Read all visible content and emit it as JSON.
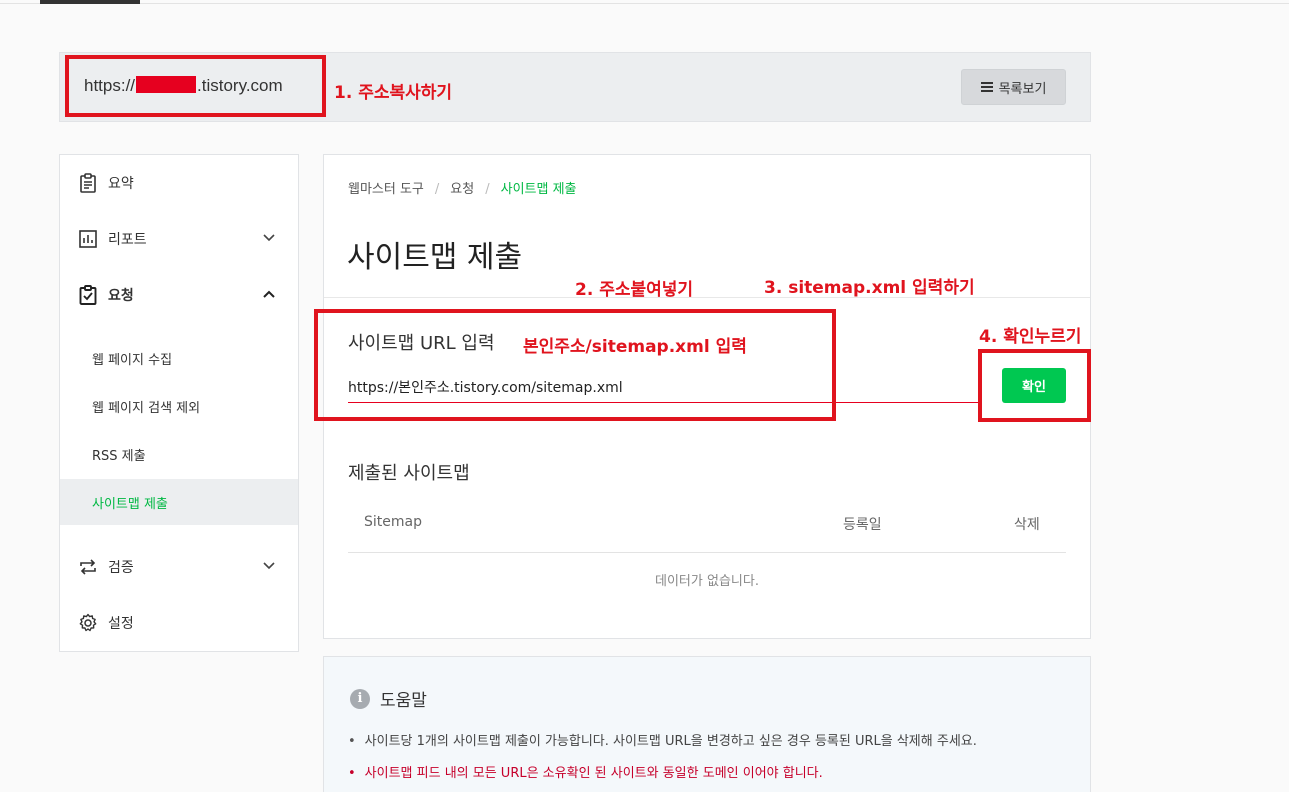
{
  "header": {
    "url_prefix": "https://",
    "url_suffix": ".tistory.com",
    "list_button": "목록보기"
  },
  "sidebar": {
    "items": [
      {
        "label": "요약",
        "icon": "clipboard-icon"
      },
      {
        "label": "리포트",
        "icon": "bar-chart-icon"
      },
      {
        "label": "요청",
        "icon": "clipboard-check-icon"
      },
      {
        "label": "검증",
        "icon": "swap-arrows-icon"
      },
      {
        "label": "설정",
        "icon": "gear-icon"
      }
    ],
    "sub_items": [
      {
        "label": "웹 페이지 수집"
      },
      {
        "label": "웹 페이지 검색 제외"
      },
      {
        "label": "RSS 제출"
      },
      {
        "label": "사이트맵 제출",
        "active": true
      }
    ]
  },
  "breadcrumb": {
    "items": [
      "웹마스터 도구",
      "요청",
      "사이트맵 제출"
    ],
    "separator": "/"
  },
  "main": {
    "title": "사이트맵 제출",
    "url_label": "사이트맵 URL 입력",
    "url_value": "https://본인주소.tistory.com/sitemap.xml",
    "confirm_button": "확인",
    "submitted_title": "제출된 사이트맵",
    "table_headers": [
      "Sitemap",
      "등록일",
      "삭제"
    ],
    "empty_text": "데이터가 없습니다."
  },
  "help": {
    "title": "도움말",
    "bullets": [
      "사이트당 1개의 사이트맵 제출이 가능합니다. 사이트맵 URL을 변경하고 싶은 경우 등록된 URL을 삭제해 주세요.",
      "사이트맵 피드 내의 모든 URL은 소유확인 된 사이트와 동일한 도메인 이어야 합니다."
    ]
  },
  "annotations": {
    "step1": "1. 주소복사하기",
    "step2": "2. 주소붙여넣기",
    "step3": "3. sitemap.xml 입력하기",
    "step4": "4. 확인누르기",
    "inline_note": "본인주소/sitemap.xml 입력"
  },
  "colors": {
    "accent_green": "#00c851",
    "annotation_red": "#e0141e"
  }
}
